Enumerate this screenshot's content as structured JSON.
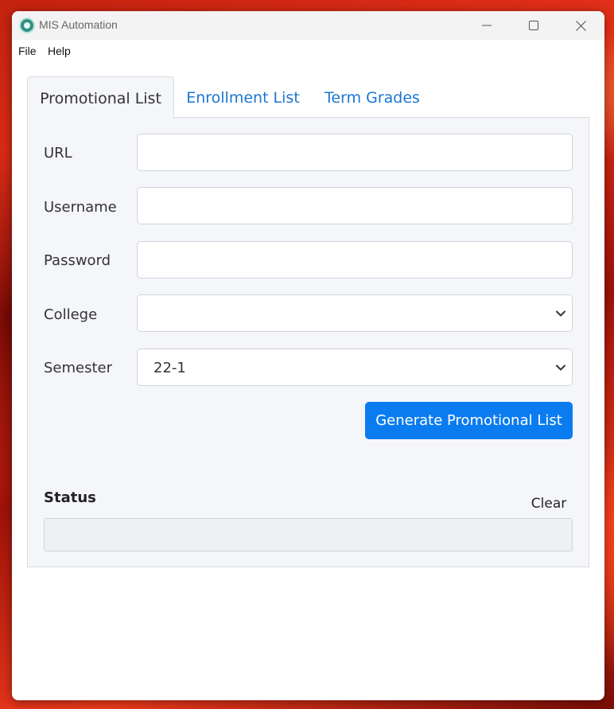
{
  "window": {
    "title": "MIS Automation",
    "app_icon": "seal-icon"
  },
  "menu": {
    "items": [
      {
        "label": "File"
      },
      {
        "label": "Help"
      }
    ]
  },
  "tabs": [
    {
      "label": "Promotional List",
      "active": true
    },
    {
      "label": "Enrollment List",
      "active": false
    },
    {
      "label": "Term Grades",
      "active": false
    }
  ],
  "form": {
    "url": {
      "label": "URL",
      "value": ""
    },
    "username": {
      "label": "Username",
      "value": ""
    },
    "password": {
      "label": "Password",
      "value": ""
    },
    "college": {
      "label": "College",
      "value": ""
    },
    "semester": {
      "label": "Semester",
      "value": "22-1"
    }
  },
  "actions": {
    "generate_label": "Generate Promotional List",
    "clear_label": "Clear"
  },
  "status": {
    "label": "Status",
    "text": ""
  },
  "colors": {
    "accent": "#0b7cf0",
    "tab_link": "#1a76d2"
  }
}
